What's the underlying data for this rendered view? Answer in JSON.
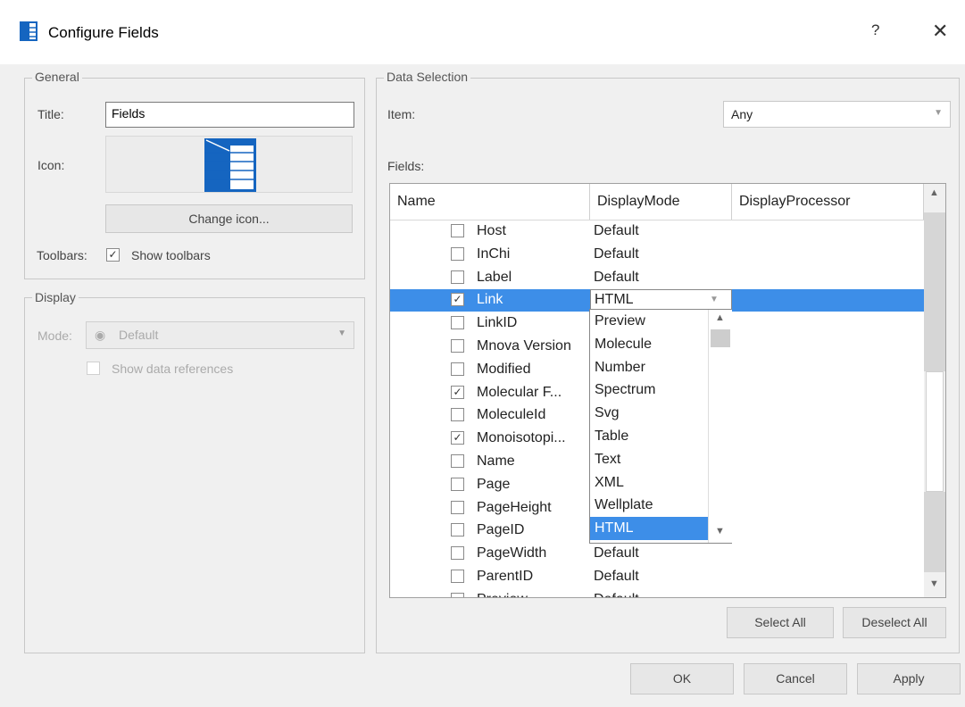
{
  "window": {
    "title": "Configure Fields",
    "help_label": "?",
    "close_label": "✕"
  },
  "general": {
    "group_label": "General",
    "title_label": "Title:",
    "title_value": "Fields",
    "icon_label": "Icon:",
    "change_icon_label": "Change icon...",
    "toolbars_label": "Toolbars:",
    "show_toolbars_label": "Show toolbars",
    "show_toolbars_checked": true
  },
  "display": {
    "group_label": "Display",
    "mode_label": "Mode:",
    "mode_value": "Default",
    "show_refs_label": "Show data references"
  },
  "data_selection": {
    "group_label": "Data Selection",
    "item_label": "Item:",
    "item_value": "Any",
    "fields_label": "Fields:",
    "columns": [
      "Name",
      "DisplayMode",
      "DisplayProcessor"
    ],
    "rows": [
      {
        "name": "Host",
        "mode": "Default",
        "checked": false
      },
      {
        "name": "InChi",
        "mode": "Default",
        "checked": false
      },
      {
        "name": "Label",
        "mode": "Default",
        "checked": false
      },
      {
        "name": "Link",
        "mode": "HTML",
        "checked": true,
        "selected": true
      },
      {
        "name": "LinkID",
        "mode": "",
        "checked": false
      },
      {
        "name": "Mnova Version",
        "mode": "",
        "checked": false
      },
      {
        "name": "Modified",
        "mode": "",
        "checked": false
      },
      {
        "name": "Molecular F...",
        "mode": "",
        "checked": true
      },
      {
        "name": "MoleculeId",
        "mode": "",
        "checked": false
      },
      {
        "name": "Monoisotopi...",
        "mode": "",
        "checked": true
      },
      {
        "name": "Name",
        "mode": "",
        "checked": false
      },
      {
        "name": "Page",
        "mode": "",
        "checked": false
      },
      {
        "name": "PageHeight",
        "mode": "",
        "checked": false
      },
      {
        "name": "PageID",
        "mode": "",
        "checked": false
      },
      {
        "name": "PageWidth",
        "mode": "Default",
        "checked": false
      },
      {
        "name": "ParentID",
        "mode": "Default",
        "checked": false
      },
      {
        "name": "Preview",
        "mode": "Default",
        "checked": false
      }
    ],
    "dropdown_options": [
      "Preview",
      "Molecule",
      "Number",
      "Spectrum",
      "Svg",
      "Table",
      "Text",
      "XML",
      "Wellplate",
      "HTML"
    ],
    "dropdown_highlighted": "HTML",
    "select_all_label": "Select All",
    "deselect_all_label": "Deselect All"
  },
  "footer": {
    "ok_label": "OK",
    "cancel_label": "Cancel",
    "apply_label": "Apply"
  },
  "colors": {
    "selection": "#3d8ee8",
    "icon_blue": "#1565c0"
  }
}
